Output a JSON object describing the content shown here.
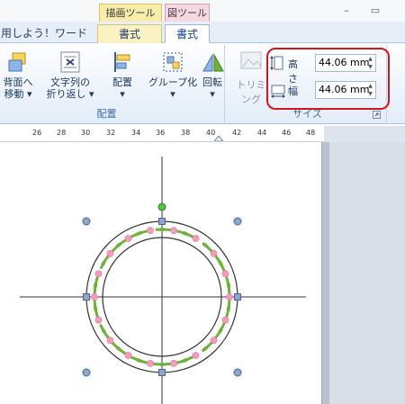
{
  "contextual_groups": {
    "drawing_tools": "描画ツール",
    "picture_tools": "図ツール"
  },
  "window": {
    "minimize": "–",
    "restore": "▭"
  },
  "tabs": [
    {
      "label": "用しよう！ワード"
    },
    {
      "label": "書式"
    },
    {
      "label": "書式"
    }
  ],
  "ribbon": {
    "arrange_group": {
      "label": "配置",
      "buttons": [
        {
          "label": "背面へ\n移動 ▾"
        },
        {
          "label": "文字列の\n折り返し ▾"
        },
        {
          "label": "配置\n▾"
        },
        {
          "label": "グループ化\n▾"
        },
        {
          "label": "回転\n▾"
        }
      ]
    },
    "size_group": {
      "label": "サイズ",
      "trimming": "トリミング",
      "height_label": "高さ",
      "height_value": "44.06 mm",
      "width_label": "幅",
      "width_value": "44.06 mm"
    }
  },
  "ruler": {
    "ticks": [
      "26",
      "28",
      "30",
      "32",
      "34",
      "36",
      "38",
      "40",
      "42",
      "44",
      "46",
      "48"
    ]
  },
  "colors": {
    "highlight": "#d0171d",
    "wreath_leaf": "#6fb23a",
    "wreath_flower": "#f29bbd",
    "handle": "#8fa6c9"
  }
}
